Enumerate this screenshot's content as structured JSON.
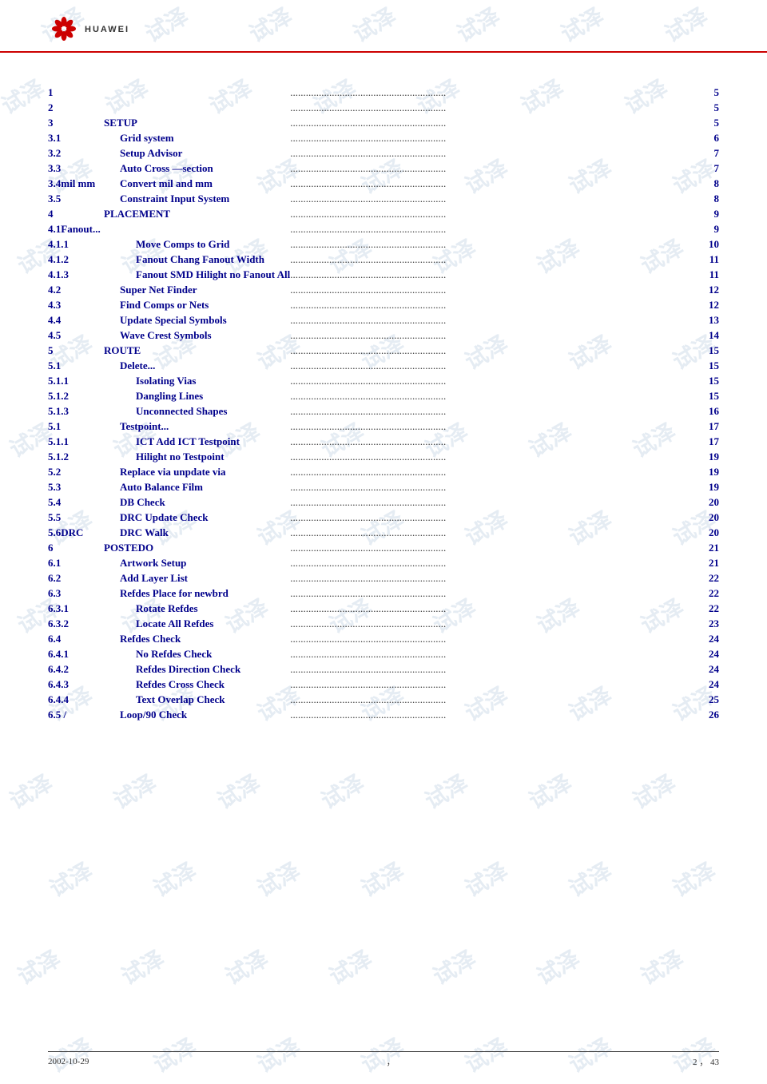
{
  "header": {
    "logo_text": "HUAWEI"
  },
  "toc": {
    "entries": [
      {
        "num": "1",
        "title": "",
        "dots": true,
        "page": "5"
      },
      {
        "num": "2",
        "title": "",
        "dots": true,
        "page": "5"
      },
      {
        "num": "3",
        "title": "SETUP",
        "dots": true,
        "page": "5"
      },
      {
        "num": "3.1",
        "title": "Grid system",
        "dots": true,
        "page": "6"
      },
      {
        "num": "3.2",
        "title": "Setup Advisor",
        "dots": true,
        "page": "7"
      },
      {
        "num": "3.3",
        "title": "Auto Cross —section",
        "dots": true,
        "page": "7"
      },
      {
        "num": "3.4mil  mm",
        "title": "Convert mil and mm",
        "dots": true,
        "page": "8"
      },
      {
        "num": "3.5",
        "title": "Constraint Input System",
        "dots": true,
        "page": "8"
      },
      {
        "num": "4",
        "title": "PLACEMENT",
        "dots": true,
        "page": "9"
      },
      {
        "num": "4.1Fanout...",
        "title": "",
        "dots": true,
        "page": "9"
      },
      {
        "num": "4.1.1",
        "title": "Move Comps to Grid",
        "dots": true,
        "page": "10"
      },
      {
        "num": "4.1.2",
        "title": "Fanout    Chang Fanout Width",
        "dots": true,
        "page": "11"
      },
      {
        "num": "4.1.3",
        "title": "Fanout SMD Hilight no Fanout All",
        "dots": true,
        "page": "11"
      },
      {
        "num": "4.2",
        "title": "Super Net Finder",
        "dots": true,
        "page": "12"
      },
      {
        "num": "4.3",
        "title": "Find Comps or Nets",
        "dots": true,
        "page": "12"
      },
      {
        "num": "4.4",
        "title": "Update Special Symbols",
        "dots": true,
        "page": "13"
      },
      {
        "num": "4.5",
        "title": "Wave Crest Symbols",
        "dots": true,
        "page": "14"
      },
      {
        "num": "5",
        "title": "ROUTE",
        "dots": true,
        "page": "15"
      },
      {
        "num": "5.1",
        "title": "Delete...",
        "dots": true,
        "page": "15"
      },
      {
        "num": "5.1.1",
        "title": "Isolating Vias",
        "dots": true,
        "page": "15"
      },
      {
        "num": "5.1.2",
        "title": "Dangling Lines",
        "dots": true,
        "page": "15"
      },
      {
        "num": "5.1.3",
        "title": "Unconnected Shapes",
        "dots": true,
        "page": "16"
      },
      {
        "num": "5.1",
        "title": "Testpoint...",
        "dots": true,
        "page": "17"
      },
      {
        "num": "5.1.1",
        "title": "ICT     Add ICT Testpoint",
        "dots": true,
        "page": "17"
      },
      {
        "num": "5.1.2",
        "title": "Hilight no Testpoint",
        "dots": true,
        "page": "19"
      },
      {
        "num": "5.2",
        "title": "Replace via  unpdate via",
        "dots": true,
        "page": "19"
      },
      {
        "num": "5.3",
        "title": "Auto Balance Film",
        "dots": true,
        "page": "19"
      },
      {
        "num": "5.4",
        "title": "DB Check",
        "dots": true,
        "page": "20"
      },
      {
        "num": "5.5",
        "title": "DRC Update Check",
        "dots": true,
        "page": "20"
      },
      {
        "num": "5.6DRC",
        "title": "DRC Walk",
        "dots": true,
        "page": "20"
      },
      {
        "num": "6",
        "title": "POSTEDO",
        "dots": true,
        "page": "21"
      },
      {
        "num": "6.1",
        "title": "Artwork Setup",
        "dots": true,
        "page": "21"
      },
      {
        "num": "6.2",
        "title": "Add Layer List",
        "dots": true,
        "page": "22"
      },
      {
        "num": "6.3",
        "title": "Refdes Place for newbrd",
        "dots": true,
        "page": "22"
      },
      {
        "num": "6.3.1",
        "title": "Rotate Refdes",
        "dots": true,
        "page": "22"
      },
      {
        "num": "6.3.2",
        "title": "Locate All Refdes",
        "dots": true,
        "page": "23"
      },
      {
        "num": "6.4",
        "title": "Refdes Check",
        "dots": true,
        "page": "24"
      },
      {
        "num": "6.4.1",
        "title": "No Refdes Check",
        "dots": true,
        "page": "24"
      },
      {
        "num": "6.4.2",
        "title": "Refdes Direction  Check",
        "dots": true,
        "page": "24"
      },
      {
        "num": "6.4.3",
        "title": "Refdes Cross Check",
        "dots": true,
        "page": "24"
      },
      {
        "num": "6.4.4",
        "title": "Text Overlap Check",
        "dots": true,
        "page": "25"
      },
      {
        "num": "6.5    /",
        "title": "Loop/90 Check",
        "dots": true,
        "page": "26"
      }
    ]
  },
  "footer": {
    "date": "2002-10-29",
    "center": "，",
    "right": "2  ，  43"
  }
}
